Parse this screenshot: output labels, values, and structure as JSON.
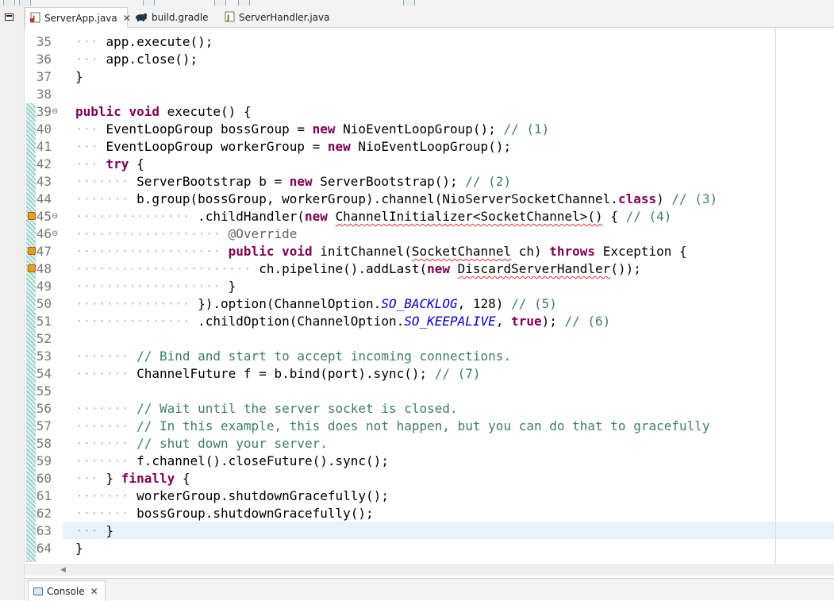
{
  "tabs": [
    {
      "label": "ServerApp.java",
      "icon": "java-file-icon",
      "active": true,
      "closable": true
    },
    {
      "label": "build.gradle",
      "icon": "gradle-icon",
      "active": false,
      "closable": false
    },
    {
      "label": "ServerHandler.java",
      "icon": "java-file-icon",
      "active": false,
      "closable": false
    }
  ],
  "console": {
    "label": "Console"
  },
  "colors": {
    "keyword": "#7f0055",
    "comment": "#3f7f5f",
    "field": "#0000c0",
    "line_highlight": "#e8f2fe"
  },
  "current_line": 63,
  "lines": [
    {
      "n": "35",
      "indent": 2,
      "tokens": [
        [
          "app.execute();",
          ""
        ]
      ]
    },
    {
      "n": "36",
      "indent": 2,
      "tokens": [
        [
          "app.close();",
          ""
        ]
      ]
    },
    {
      "n": "37",
      "indent": 1,
      "tokens": [
        [
          "}",
          ""
        ]
      ]
    },
    {
      "n": "38",
      "indent": 0,
      "tokens": []
    },
    {
      "n": "39",
      "indent": 1,
      "fold": true,
      "tokens": [
        [
          "public",
          "kw"
        ],
        [
          " ",
          ""
        ],
        [
          "void",
          "kw"
        ],
        [
          " execute() {",
          ""
        ]
      ]
    },
    {
      "n": "40",
      "indent": 2,
      "tokens": [
        [
          "EventLoopGroup bossGroup = ",
          ""
        ],
        [
          "new",
          "kw"
        ],
        [
          " NioEventLoopGroup(); ",
          ""
        ],
        [
          "// (1)",
          "cm"
        ]
      ]
    },
    {
      "n": "41",
      "indent": 2,
      "tokens": [
        [
          "EventLoopGroup workerGroup = ",
          ""
        ],
        [
          "new",
          "kw"
        ],
        [
          " NioEventLoopGroup();",
          ""
        ]
      ]
    },
    {
      "n": "42",
      "indent": 2,
      "tokens": [
        [
          "try",
          "kw"
        ],
        [
          " {",
          ""
        ]
      ]
    },
    {
      "n": "43",
      "indent": 3,
      "tokens": [
        [
          "ServerBootstrap b = ",
          ""
        ],
        [
          "new",
          "kw"
        ],
        [
          " ServerBootstrap(); ",
          ""
        ],
        [
          "// (2)",
          "cm"
        ]
      ]
    },
    {
      "n": "44",
      "indent": 3,
      "tokens": [
        [
          "b.group(bossGroup, workerGroup).channel(NioServerSocketChannel.",
          ""
        ],
        [
          "class",
          "kw"
        ],
        [
          ") ",
          ""
        ],
        [
          "// (3)",
          "cm"
        ]
      ]
    },
    {
      "n": "45",
      "indent": 5,
      "fold": true,
      "warn": true,
      "tokens": [
        [
          ".childHandler(",
          ""
        ],
        [
          "new",
          "kw"
        ],
        [
          " ",
          ""
        ],
        [
          "ChannelInitializer<SocketChannel>()",
          "squig"
        ],
        [
          " { ",
          ""
        ],
        [
          "// (4)",
          "cm"
        ]
      ]
    },
    {
      "n": "46",
      "indent": 6,
      "fold": true,
      "tokens": [
        [
          "@Override",
          "ann"
        ]
      ]
    },
    {
      "n": "47",
      "indent": 6,
      "warn": true,
      "tokens": [
        [
          "public",
          "kw"
        ],
        [
          " ",
          ""
        ],
        [
          "void",
          "kw"
        ],
        [
          " initChannel(",
          ""
        ],
        [
          "SocketChannel",
          "squig"
        ],
        [
          " ch) ",
          ""
        ],
        [
          "throws",
          "kw"
        ],
        [
          " Exception {",
          ""
        ]
      ]
    },
    {
      "n": "48",
      "indent": 7,
      "warn": true,
      "tokens": [
        [
          "ch.pipeline().addLast(",
          ""
        ],
        [
          "new",
          "kw"
        ],
        [
          " ",
          ""
        ],
        [
          "DiscardServerHandler",
          "squig"
        ],
        [
          "());",
          ""
        ]
      ]
    },
    {
      "n": "49",
      "indent": 6,
      "tokens": [
        [
          "}",
          ""
        ]
      ]
    },
    {
      "n": "50",
      "indent": 5,
      "tokens": [
        [
          "}).option(ChannelOption.",
          ""
        ],
        [
          "SO_BACKLOG",
          "fld"
        ],
        [
          ", 128) ",
          ""
        ],
        [
          "// (5)",
          "cm"
        ]
      ]
    },
    {
      "n": "51",
      "indent": 5,
      "tokens": [
        [
          ".childOption(ChannelOption.",
          ""
        ],
        [
          "SO_KEEPALIVE",
          "fld"
        ],
        [
          ", ",
          ""
        ],
        [
          "true",
          "kw"
        ],
        [
          "); ",
          ""
        ],
        [
          "// (6)",
          "cm"
        ]
      ]
    },
    {
      "n": "52",
      "indent": 0,
      "tokens": []
    },
    {
      "n": "53",
      "indent": 3,
      "tokens": [
        [
          "// Bind and start to accept incoming connections.",
          "cm"
        ]
      ]
    },
    {
      "n": "54",
      "indent": 3,
      "tokens": [
        [
          "ChannelFuture f = b.bind(port).sync(); ",
          ""
        ],
        [
          "// (7)",
          "cm"
        ]
      ]
    },
    {
      "n": "55",
      "indent": 0,
      "tokens": []
    },
    {
      "n": "56",
      "indent": 3,
      "tokens": [
        [
          "// Wait until the server socket is closed.",
          "cm"
        ]
      ]
    },
    {
      "n": "57",
      "indent": 3,
      "tokens": [
        [
          "// In this example, this does not happen, but you can do that to gracefully",
          "cm"
        ]
      ]
    },
    {
      "n": "58",
      "indent": 3,
      "tokens": [
        [
          "// shut down your server.",
          "cm"
        ]
      ]
    },
    {
      "n": "59",
      "indent": 3,
      "tokens": [
        [
          "f.channel().closeFuture().sync();",
          ""
        ]
      ]
    },
    {
      "n": "60",
      "indent": 2,
      "tokens": [
        [
          "} ",
          ""
        ],
        [
          "finally",
          "kw"
        ],
        [
          " {",
          ""
        ]
      ]
    },
    {
      "n": "61",
      "indent": 3,
      "tokens": [
        [
          "workerGroup.shutdownGracefully();",
          ""
        ]
      ]
    },
    {
      "n": "62",
      "indent": 3,
      "tokens": [
        [
          "bossGroup.shutdownGracefully();",
          ""
        ]
      ]
    },
    {
      "n": "63",
      "indent": 2,
      "tokens": [
        [
          "}",
          ""
        ]
      ]
    },
    {
      "n": "64",
      "indent": 1,
      "tokens": [
        [
          "}",
          ""
        ]
      ]
    }
  ]
}
